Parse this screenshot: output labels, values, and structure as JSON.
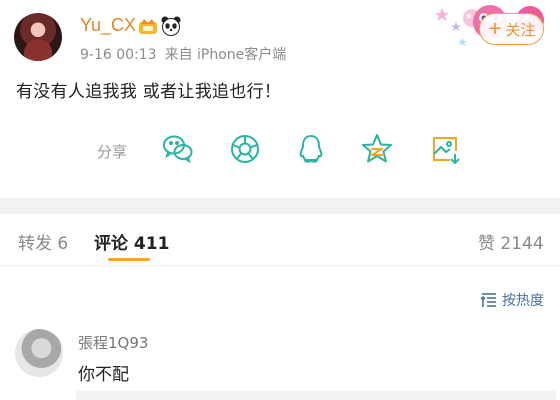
{
  "post": {
    "username": "Yu_CX",
    "timestamp": "9-16 00:13",
    "source": "来自 iPhone客户端",
    "text": "有没有人追我我 或者让我追也行！",
    "follow_label": "关注",
    "follow_plus": "+"
  },
  "share": {
    "label": "分享",
    "icons": [
      "wechat-icon",
      "moments-icon",
      "qq-icon",
      "qzone-star-icon",
      "save-image-icon"
    ]
  },
  "tabs": {
    "repost": "转发 6",
    "comments": "评论 411",
    "likes": "赞 2144"
  },
  "sort": {
    "label": "按热度",
    "icon": "sort-icon"
  },
  "comments": [
    {
      "author": "張程1Q93",
      "text": "你不配"
    }
  ],
  "colors": {
    "username": "#e8832a",
    "follow": "#f08f2a",
    "share_icons": "#2bb3a3",
    "tab_underline": "#f5a623",
    "sort": "#4a6fa5"
  }
}
